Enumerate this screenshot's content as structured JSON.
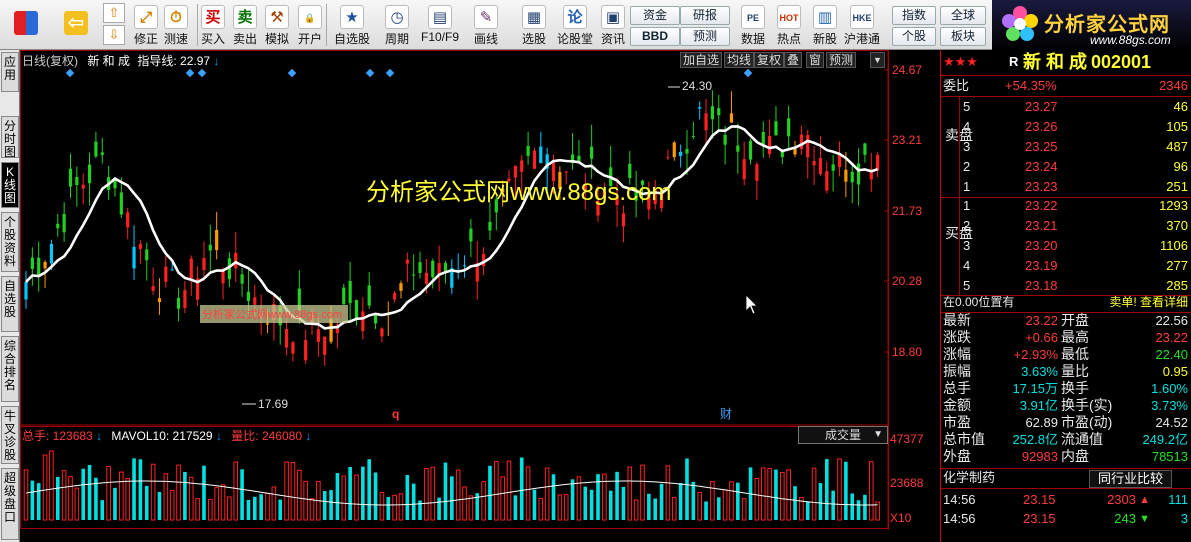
{
  "toolbar": {
    "buttons": [
      {
        "label": "修正",
        "icon": "⤢",
        "color": "#d28000"
      },
      {
        "label": "测速",
        "icon": "⏱",
        "color": "#d28000"
      },
      {
        "label": "买入",
        "icon": "买",
        "color": "#d00000"
      },
      {
        "label": "卖出",
        "icon": "卖",
        "color": "#007000"
      },
      {
        "label": "模拟",
        "icon": "⚒",
        "color": "#a04000"
      },
      {
        "label": "开户",
        "icon": "🔒",
        "color": "#555"
      },
      {
        "label": "自选股",
        "icon": "★",
        "color": "#2050a0"
      },
      {
        "label": "周期",
        "icon": "◷",
        "color": "#204070"
      },
      {
        "label": "F10/F9",
        "icon": "▤",
        "color": "#204070"
      },
      {
        "label": "画线",
        "icon": "✎",
        "color": "#703070"
      },
      {
        "label": "选股",
        "icon": "▦",
        "color": "#204070"
      },
      {
        "label": "论股堂",
        "icon": "论",
        "color": "#2060b0"
      },
      {
        "label": "资讯",
        "icon": "▣",
        "color": "#204070"
      },
      {
        "label": "数据",
        "icon": "PE",
        "color": "#204070"
      },
      {
        "label": "热点",
        "icon": "HOT",
        "color": "#c03000"
      },
      {
        "label": "新股",
        "icon": "▥",
        "color": "#2060b0"
      },
      {
        "label": "沪港通",
        "icon": "HKE",
        "color": "#204070"
      }
    ],
    "small_buttons": [
      "资金",
      "研报",
      "BBD",
      "预测",
      "指数",
      "全球",
      "个股",
      "板块"
    ]
  },
  "logo": {
    "brand": "分析家公式网",
    "url": "www.88gs.com"
  },
  "left_tabs": [
    {
      "label": "应用"
    },
    {
      "label": "分时图"
    },
    {
      "label": "K线图",
      "active": true
    },
    {
      "label": "个股资料"
    },
    {
      "label": "自选股"
    },
    {
      "label": "综合排名"
    },
    {
      "label": "牛叉诊股"
    },
    {
      "label": "超级盘口"
    }
  ],
  "chart_header": {
    "period": "日线(复权)",
    "name": "新 和 成",
    "indicator": "指导线: 22.97"
  },
  "chart_tools": [
    "加自选",
    "均线",
    "复权",
    "叠",
    "窗",
    "预测"
  ],
  "price_axis": [
    "24.67",
    "23.21",
    "21.73",
    "20.28",
    "18.80"
  ],
  "annotations": {
    "high": "24.30",
    "low": "17.69",
    "q_mark": "q",
    "cai_mark": "财"
  },
  "watermark_main": "分析家公式网www.88gs.com",
  "watermark_small": "分析家公式网www.88gs.com",
  "volume_header": {
    "total": "总手: 123683",
    "mavol": "MAVOL10: 217529",
    "ratio": "量比: 246080",
    "selector": "成交量"
  },
  "volume_axis": [
    "47377",
    "23688",
    "X10"
  ],
  "quote": {
    "stars": "★★★",
    "r": "R",
    "name": "新 和 成",
    "code": "002001",
    "weibi_label": "委比",
    "weibi_value": "+54.35%",
    "weibi_count": "2346",
    "sell_label": "卖盘",
    "buy_label": "买盘",
    "sell": [
      {
        "level": "5",
        "price": "23.27",
        "volume": "46"
      },
      {
        "level": "4",
        "price": "23.26",
        "volume": "105"
      },
      {
        "level": "3",
        "price": "23.25",
        "volume": "487"
      },
      {
        "level": "2",
        "price": "23.24",
        "volume": "96"
      },
      {
        "level": "1",
        "price": "23.23",
        "volume": "251"
      }
    ],
    "buy": [
      {
        "level": "1",
        "price": "23.22",
        "volume": "1293"
      },
      {
        "level": "2",
        "price": "23.21",
        "volume": "370"
      },
      {
        "level": "3",
        "price": "23.20",
        "volume": "1106"
      },
      {
        "level": "4",
        "price": "23.19",
        "volume": "277"
      },
      {
        "level": "5",
        "price": "23.18",
        "volume": "285"
      }
    ],
    "position_note": "在0.00位置有",
    "single_note": "卖单! 查看详细",
    "stats": [
      {
        "l1": "最新",
        "v1": "23.22",
        "c1": "red",
        "l2": "开盘",
        "v2": "22.56",
        "c2": "white"
      },
      {
        "l1": "涨跌",
        "v1": "+0.66",
        "c1": "red",
        "l2": "最高",
        "v2": "23.22",
        "c2": "red"
      },
      {
        "l1": "涨幅",
        "v1": "+2.93%",
        "c1": "red",
        "l2": "最低",
        "v2": "22.40",
        "c2": "green"
      },
      {
        "l1": "振幅",
        "v1": "3.63%",
        "c1": "cyan",
        "l2": "量比",
        "v2": "0.95",
        "c2": "yellow"
      },
      {
        "l1": "总手",
        "v1": "17.15万",
        "c1": "cyan",
        "l2": "换手",
        "v2": "1.60%",
        "c2": "cyan"
      },
      {
        "l1": "金额",
        "v1": "3.91亿",
        "c1": "cyan",
        "l2": "换手(实)",
        "v2": "3.73%",
        "c2": "cyan"
      },
      {
        "l1": "市盈",
        "v1": "62.89",
        "c1": "white",
        "l2": "市盈(动)",
        "v2": "24.52",
        "c2": "white"
      },
      {
        "l1": "总市值",
        "v1": "252.8亿",
        "c1": "cyan",
        "l2": "流通值",
        "v2": "249.2亿",
        "c2": "cyan"
      },
      {
        "l1": "外盘",
        "v1": "92983",
        "c1": "red",
        "l2": "内盘",
        "v2": "78513",
        "c2": "green"
      }
    ],
    "industry": "化学制药",
    "industry_compare": "同行业比较",
    "ticks": [
      {
        "time": "14:56",
        "price": "23.15",
        "volume": "2303",
        "dir": "up",
        "count": "111"
      },
      {
        "time": "14:56",
        "price": "23.15",
        "volume": "243",
        "dir": "down",
        "count": "3"
      }
    ]
  },
  "colors": {
    "up": "#ff3b3b",
    "down": "#22e022",
    "cyan": "#00e0e0",
    "grid": "#a00000"
  }
}
